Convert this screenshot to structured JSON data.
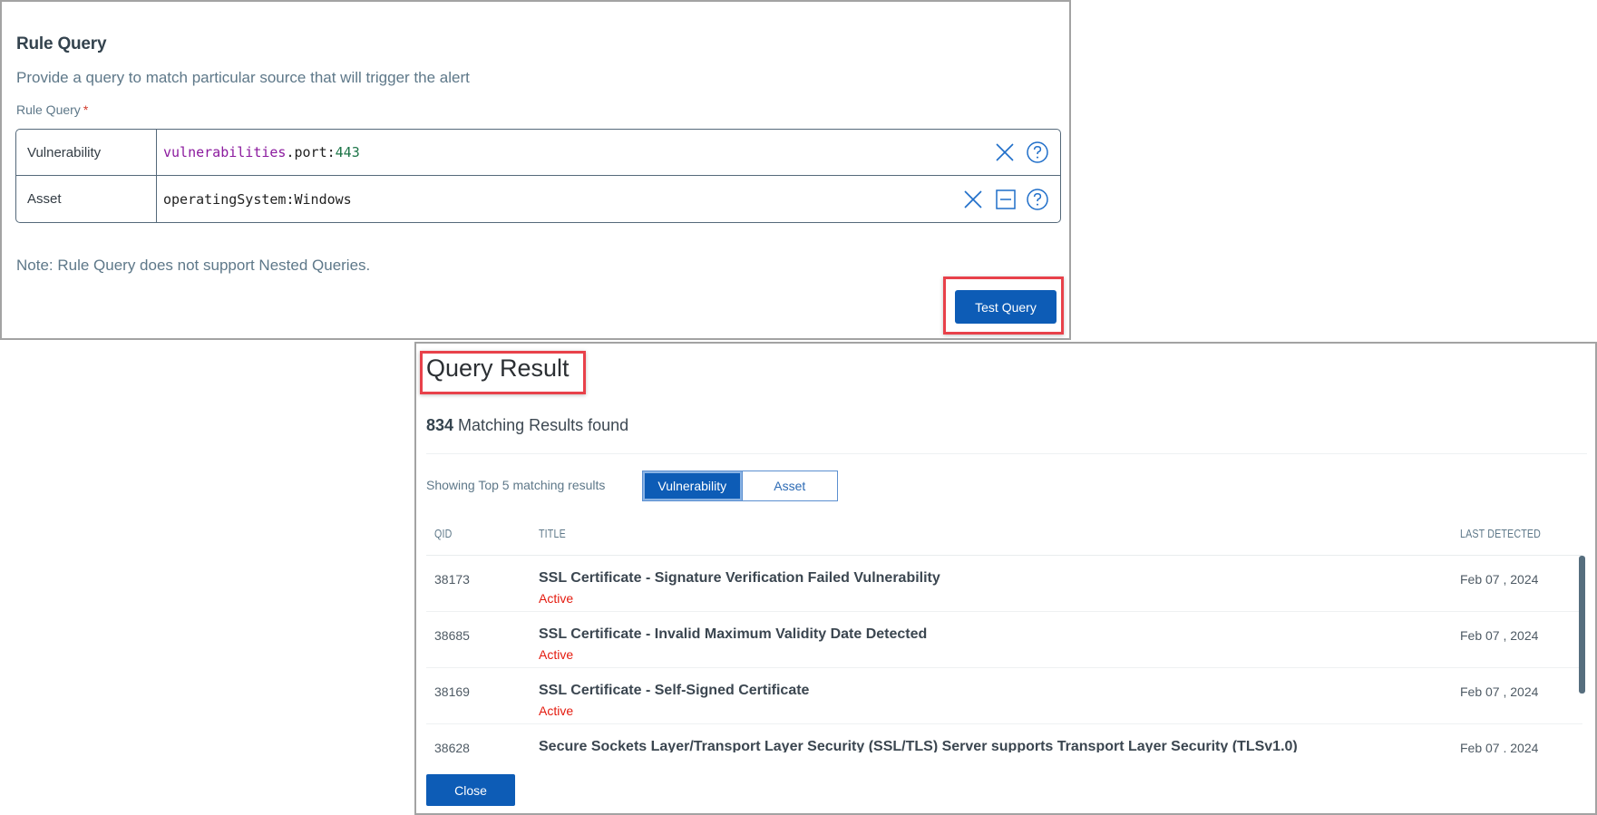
{
  "rule_query": {
    "title": "Rule Query",
    "subtitle": "Provide a query to match particular source that will trigger the alert",
    "field_label": "Rule Query",
    "required_mark": "*",
    "rows": [
      {
        "type": "Vulnerability",
        "query_tokens": [
          {
            "text": "vulnerabilities",
            "kind": "key"
          },
          {
            "text": ".port:",
            "kind": "plain"
          },
          {
            "text": "443",
            "kind": "number"
          }
        ],
        "icons": [
          "close-icon",
          "help-icon"
        ]
      },
      {
        "type": "Asset",
        "query_tokens": [
          {
            "text": "operatingSystem:Windows",
            "kind": "plain"
          }
        ],
        "icons": [
          "close-icon",
          "minus-square-icon",
          "help-icon"
        ]
      }
    ],
    "note": "Note: Rule Query does not support Nested Queries.",
    "test_button_label": "Test Query"
  },
  "query_result": {
    "title": "Query Result",
    "count": "834",
    "count_suffix": " Matching Results found",
    "showing_text": "Showing Top 5 matching results",
    "tabs": [
      {
        "label": "Vulnerability",
        "active": true
      },
      {
        "label": "Asset",
        "active": false
      }
    ],
    "columns": {
      "qid": "QID",
      "title": "Title",
      "last_detected": "Last Detected"
    },
    "rows": [
      {
        "qid": "38173",
        "title": "SSL Certificate - Signature Verification Failed Vulnerability",
        "status": "Active",
        "last_detected": "Feb 07 , 2024"
      },
      {
        "qid": "38685",
        "title": "SSL Certificate - Invalid Maximum Validity Date Detected",
        "status": "Active",
        "last_detected": "Feb 07 , 2024"
      },
      {
        "qid": "38169",
        "title": "SSL Certificate - Self-Signed Certificate",
        "status": "Active",
        "last_detected": "Feb 07 , 2024"
      },
      {
        "qid": "38628",
        "title": "Secure Sockets Layer/Transport Layer Security (SSL/TLS) Server supports Transport Layer Security (TLSv1.0)",
        "status": "",
        "last_detected": "Feb 07 , 2024"
      }
    ],
    "close_button_label": "Close"
  },
  "colors": {
    "primary": "#0d5cb6",
    "highlight": "#e8414a",
    "status_active": "#e41b0f",
    "query_key": "#8b1a9e",
    "query_number": "#1d7548"
  }
}
